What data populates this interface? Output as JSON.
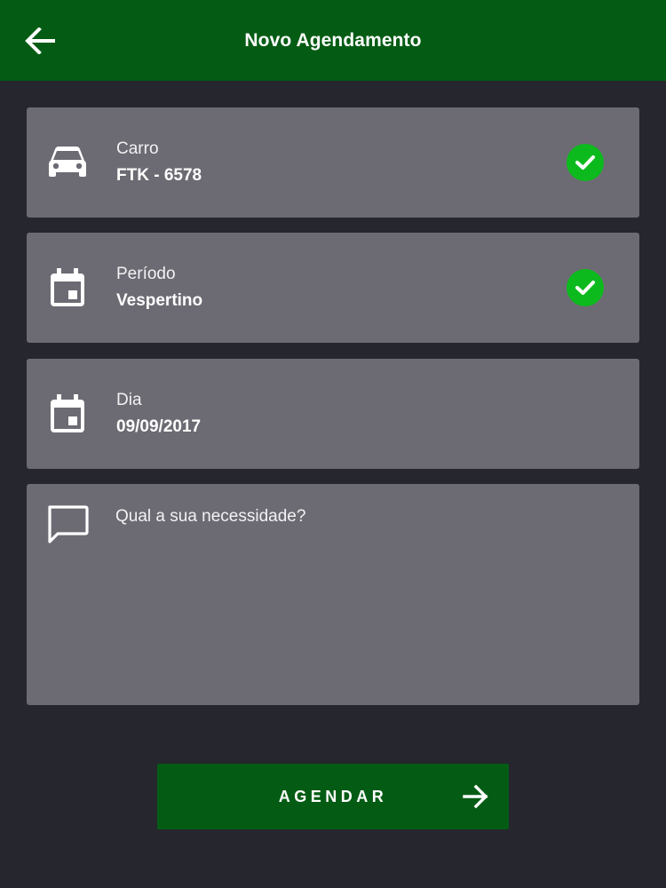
{
  "header": {
    "title": "Novo Agendamento",
    "back_icon": "arrow-left-icon"
  },
  "cards": {
    "car": {
      "label": "Carro",
      "value": "FTK - 6578",
      "icon": "car-icon",
      "checked": true
    },
    "period": {
      "label": "Período",
      "value": "Vespertino",
      "icon": "calendar-icon",
      "checked": true
    },
    "day": {
      "label": "Dia",
      "value": "09/09/2017",
      "icon": "calendar-icon",
      "checked": false
    }
  },
  "need": {
    "placeholder": "Qual a sua necessidade?",
    "value": "",
    "icon": "chat-bubble-icon"
  },
  "submit": {
    "label": "AGENDAR",
    "icon": "arrow-right-icon"
  },
  "colors": {
    "primary": "#045c14",
    "background": "#26262e",
    "card": "#6c6b73",
    "success": "#0dba1e",
    "text": "#ffffff"
  }
}
